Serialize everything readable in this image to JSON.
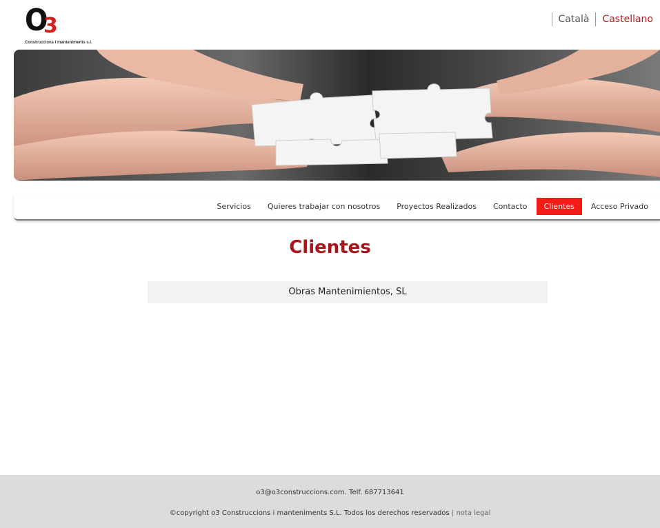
{
  "logo": {
    "mark_main": "O",
    "mark_sub": "3",
    "tagline": "Construccions i manteniments s.l."
  },
  "lang": {
    "catala": "Català",
    "castellano": "Castellano"
  },
  "banner": {
    "icon": "puzzle-hands-image"
  },
  "nav": {
    "items": [
      {
        "label": "Servicios"
      },
      {
        "label": "Quieres trabajar con nosotros"
      },
      {
        "label": "Proyectos Realizados"
      },
      {
        "label": "Contacto"
      },
      {
        "label": "Clientes",
        "active": true
      },
      {
        "label": "Acceso Privado"
      }
    ]
  },
  "main": {
    "title": "Clientes",
    "clients": [
      "Obras Mantenimientos, SL"
    ]
  },
  "footer": {
    "contact": "o3@o3construccions.com. Telf. 687713641",
    "copyright": "©copyright o3 Construccions i manteniments S.L. Todos los derechos reservados",
    "separator": "|",
    "legal_link": "nota legal"
  },
  "colors": {
    "accent": "#a8161b",
    "nav_active": "#f41a16",
    "footer_bg": "#dcdcdc"
  }
}
